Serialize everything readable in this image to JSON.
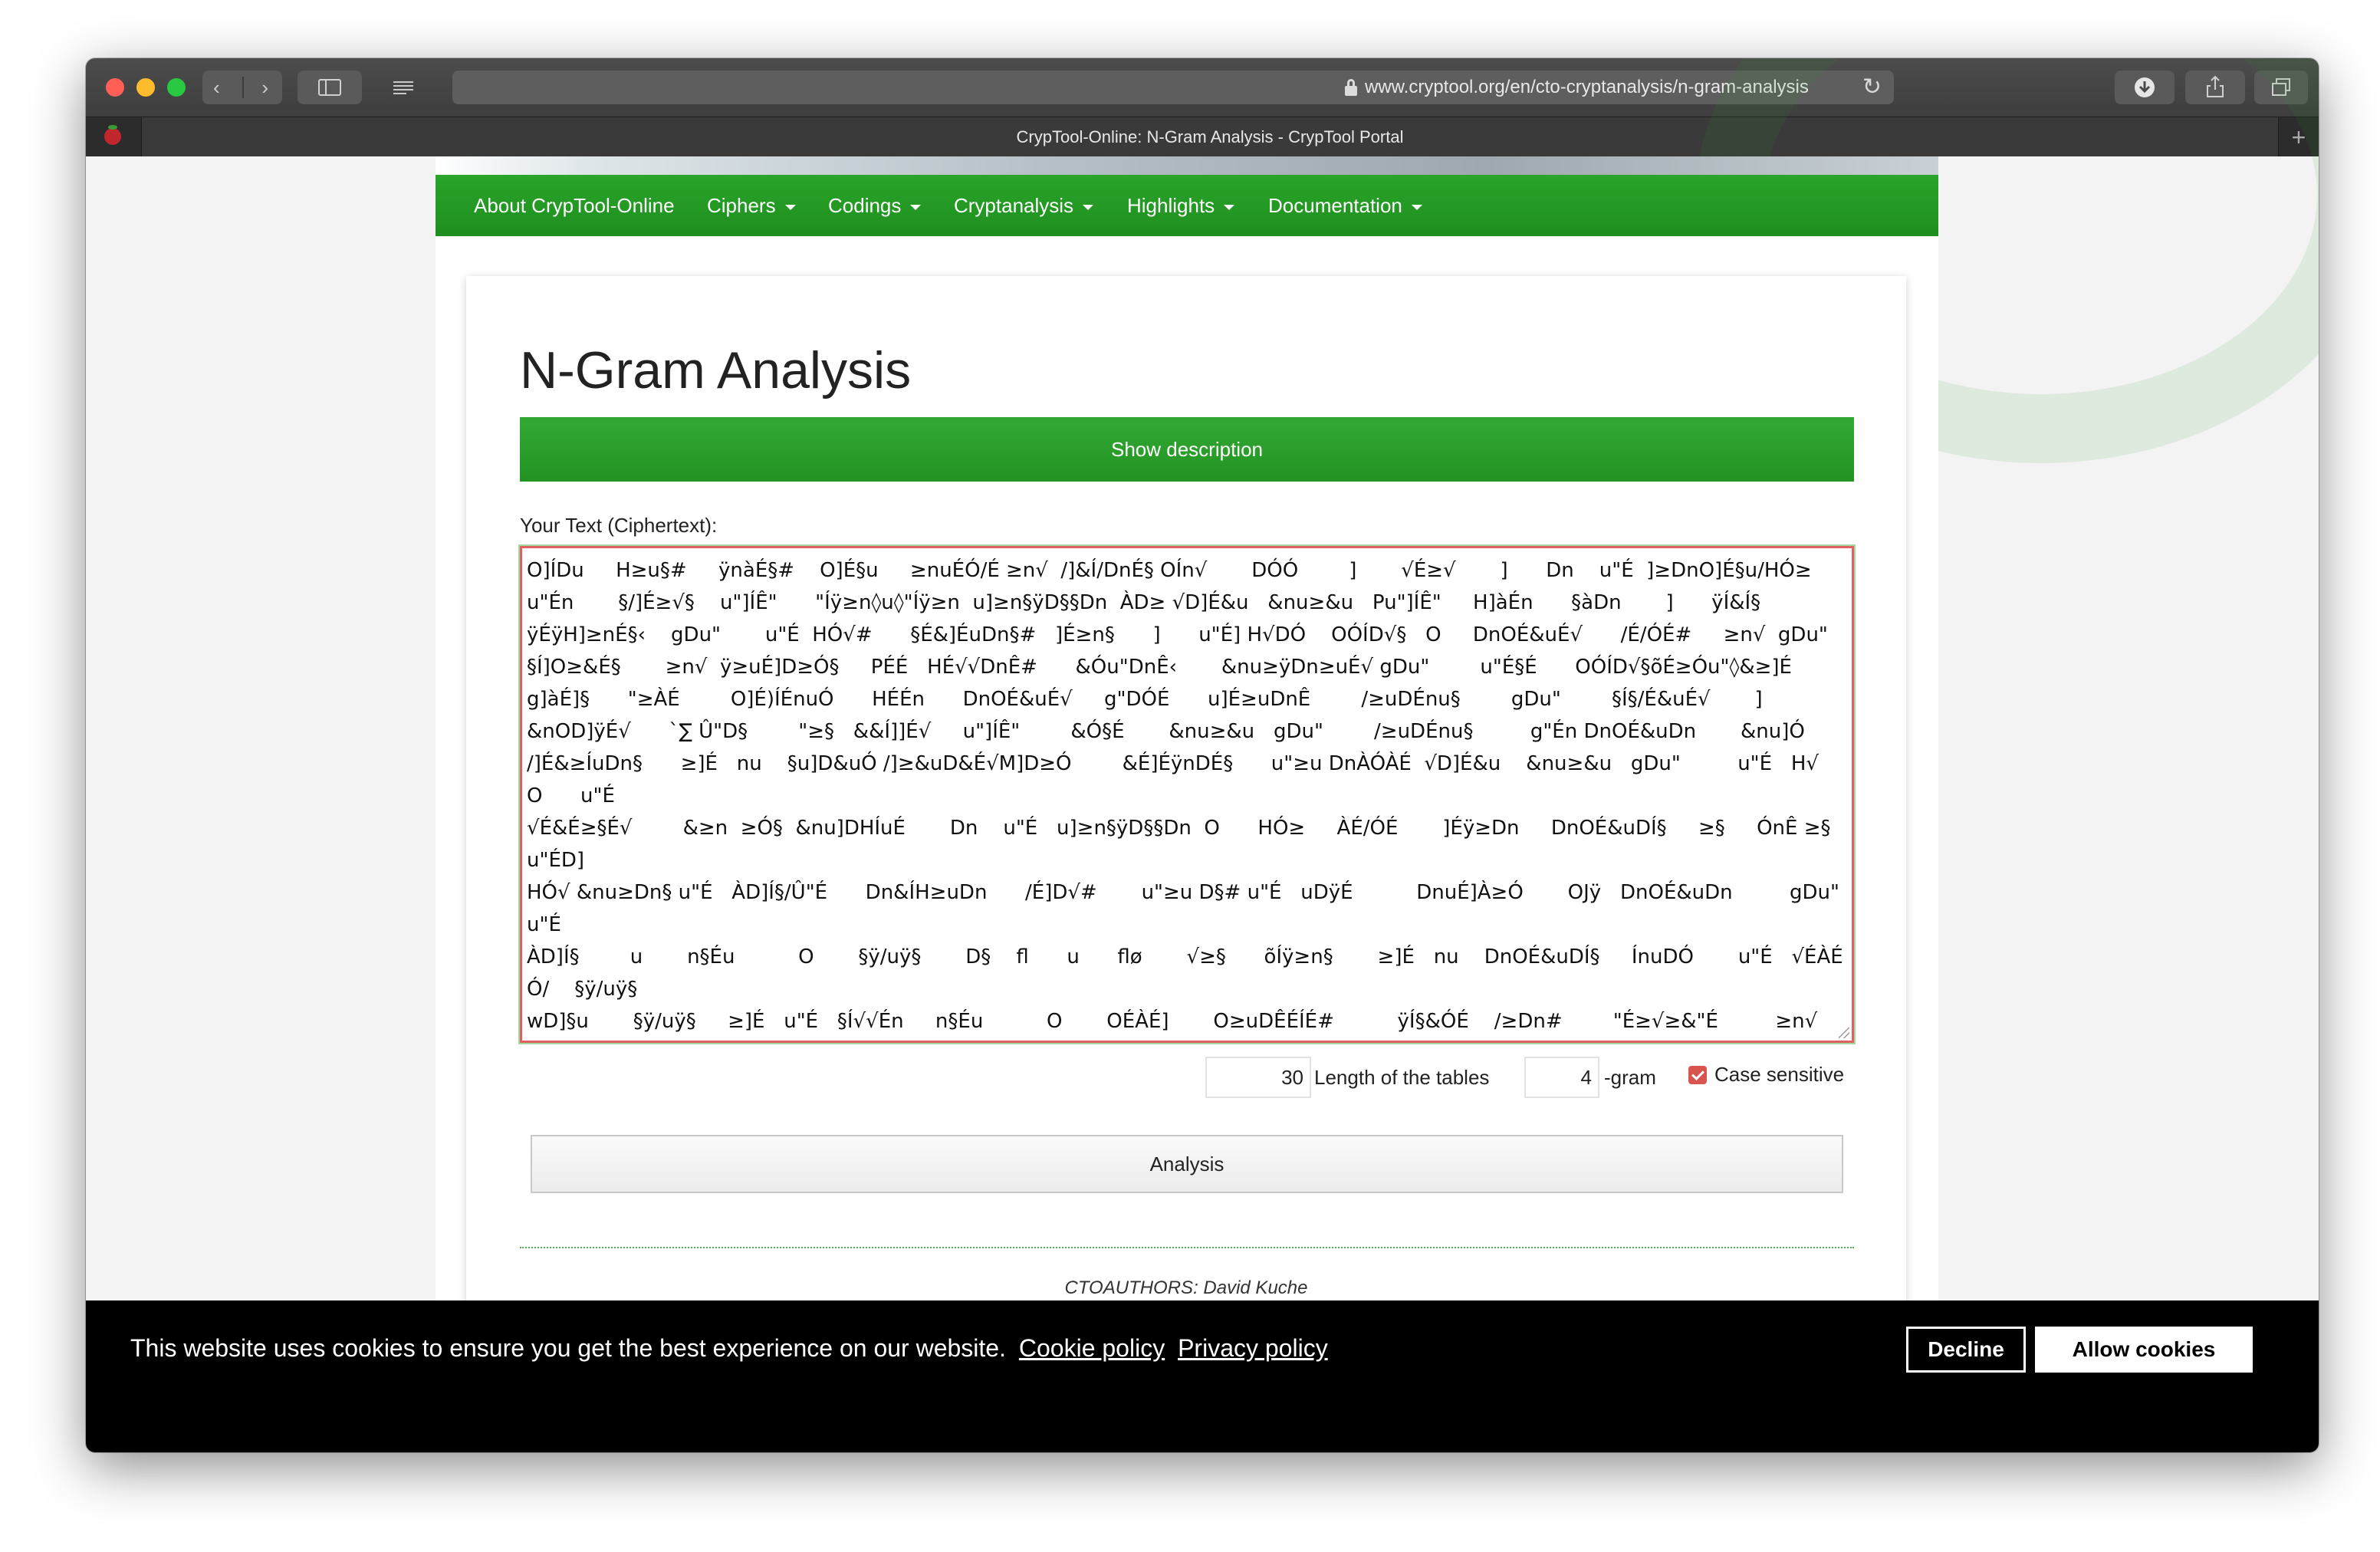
{
  "browser": {
    "url": "www.cryptool.org/en/cto-cryptanalysis/n-gram-analysis",
    "tab_title": "CrypTool-Online: N-Gram Analysis - CrypTool Portal",
    "new_tab": "+"
  },
  "nav": {
    "items": [
      {
        "label": "About CrypTool-Online",
        "dropdown": false
      },
      {
        "label": "Ciphers",
        "dropdown": true
      },
      {
        "label": "Codings",
        "dropdown": true
      },
      {
        "label": "Cryptanalysis",
        "dropdown": true
      },
      {
        "label": "Highlights",
        "dropdown": true
      },
      {
        "label": "Documentation",
        "dropdown": true
      }
    ]
  },
  "main": {
    "title": "N-Gram Analysis",
    "show_description": "Show description",
    "text_label": "Your Text (Ciphertext):",
    "ciphertext": "O]ÍDu     H≥u§#     ÿnàÉ§#    O]É§u     ≥nuÉÓ/É ≥n√  /]&Í/DnÉ§ OÍn√       DÓÓ        ]       √É≥√       ]      Dn    u\"É  ]≥DnO]É§u/HÓ≥\nu\"Én       §/]É≥√§    u\"]ÍÊ\"      \"Íÿ≥n◊u◊\"Íÿ≥n  u]≥n§ÿD§§Dn  ÀD≥ √D]É&u   &nu≥&u   Pu\"]ÍÊ\"     H]àÉn      §àDn       ]      ÿÍ&Í§\nÿÉÿH]≥nÉ§‹    gDu\"       u\"É  HÓ√#      §É&]ÉuDn§#   ]É≥n§      ]      u\"É] H√DÓ    OÓÍD√§   O     DnOÉ&uÉ√      /É/ÓÉ#     ≥n√  gDu\"\n§Í]O≥&É§       ≥n√  ÿ≥uÉ]D≥Ó§     PÉÉ   HÉ√√DnÊ#      &Óu\"DnÊ‹       &nu≥ÿDn≥uÉ√ gDu\"        u\"É§É      OÓÍD√§õÉ≥Óu\"◊&≥]É\ng]àÉ]§      \"≥ÀÉ        O]É)ÍÉnuÓ      HÉÉn      DnOÉ&uÉ√     g\"DÓÉ      u]É≥uDnÊ        /≥uDÉnu§        gDu\"        §Í§/É&uÉ√       ]\n&nOD]ÿÉ√      `∑ Û\"D§        \"≥§   &&Í]]É√     u\"]ÍÊ\"        &Ó§É       &nu≥&u   gDu\"        /≥uDÉnu§         g\"Én DnOÉ&uDn       &nu]Ó\n/]É&≥ÍuDn§      ≥]É   nu    §u]D&uÓ /]≥&uD&É√M]D≥Ó        &É]ÉÿnDÉ§      u\"≥u DnÀÓÀÉ  √D]É&u    &nu≥&u   gDu\"         u\"É   H√    O      u\"É\n√É&É≥§É√        &≥n  ≥Ó§  &nu]DHÍuÉ       Dn    u\"É   u]≥n§ÿD§§Dn  O      HÓ≥     ÀÉ/ÓÉ       ]Éÿ≥Dn     DnOÉ&uDÍ§     ≥§     ÓnÊ ≥§    u\"ÉD]\nHÓ√ &nu≥Dn§ u\"É   ÀD]Í§/Û\"É      Dn&ÍH≥uDn      /É]D√#       u\"≥u D§# u\"É   uDÿÉ          DnuÉ]À≥Ó       OJÿ   DnOÉ&uDn         gDu\"         u\"É\nÀD]Í§        u       n§Éu          O       §ÿ/uÿ§       D§    fl      u      flø       √≥§      õÍÿ≥n§       ≥]É   nu    DnOÉ&uDÍ§     ÍnuDÓ       u\"É   √ÉÀÉÓ/    §ÿ/uÿ§\nwD]§u       §ÿ/uÿ§     ≥]É   u\"É   §Í√√Én     n§Éu          O       OÉÀÉ]       O≥uDÊÉÍÉ#          ÿÍ§&ÓÉ    /≥Dn#        \"É≥√≥&\"É         ≥n√  §]É   u\"]≥u\nÛ\"D§         D§    OÓÓÓgÉ√ H       ÀÿDuDnÊ#         √D≥]]\"É≥#          ]≥§\"#            §ÿ/uÿ§       O      Dÿ/≥D]É√ àD√nÉ     ≥n√  ÓDÀÉ]      OÍn&uDn#        ≥n√\nDn   §ÿÉ  &≥§É§#   Hu\"   DnuÉ]n≥Ó        ≥n√  ÉuÉ]n≥Ó HÓÉÉ√DnÊ      PÉÉ     ÖDnÊ        Oÿ    u\"É  ÉÍÿ§#      HÓ√Dn   u\"É  §uÓ§‹\n\\≥H]≥u]    ODn√DnÊ§       Dn&ÓÍ√É Óg   g\"DuÉ        HÓ√ &ÉÓÓ        ≥n√  /Ó≥uÉÓÉu       &Ínu§         ≥n√  ÉÓÉÀ≥uÉ√         ÓDÀÉ]\nÉnÖÿÉ§õÛM¨T°àÆûg\"Ègu&ûnÛ]ûÓHûÓ≤Q"
  },
  "options": {
    "table_length": "30",
    "table_length_label": "Length of the tables",
    "ngram": "4",
    "ngram_label": "-gram",
    "case_sensitive_label": "Case sensitive",
    "case_sensitive": true
  },
  "analysis_label": "Analysis",
  "footer": {
    "authors": "CTOAUTHORS: David Kuche"
  },
  "cookie": {
    "message": "This website uses cookies to ensure you get the best experience on our website.",
    "cookie_policy": "Cookie policy",
    "privacy_policy": "Privacy policy",
    "decline": "Decline",
    "allow": "Allow cookies"
  },
  "colors": {
    "nav_green": "#239323",
    "accent_green": "#2a9f2a",
    "cookie_bg": "#000000",
    "checkbox": "#d9534f"
  }
}
